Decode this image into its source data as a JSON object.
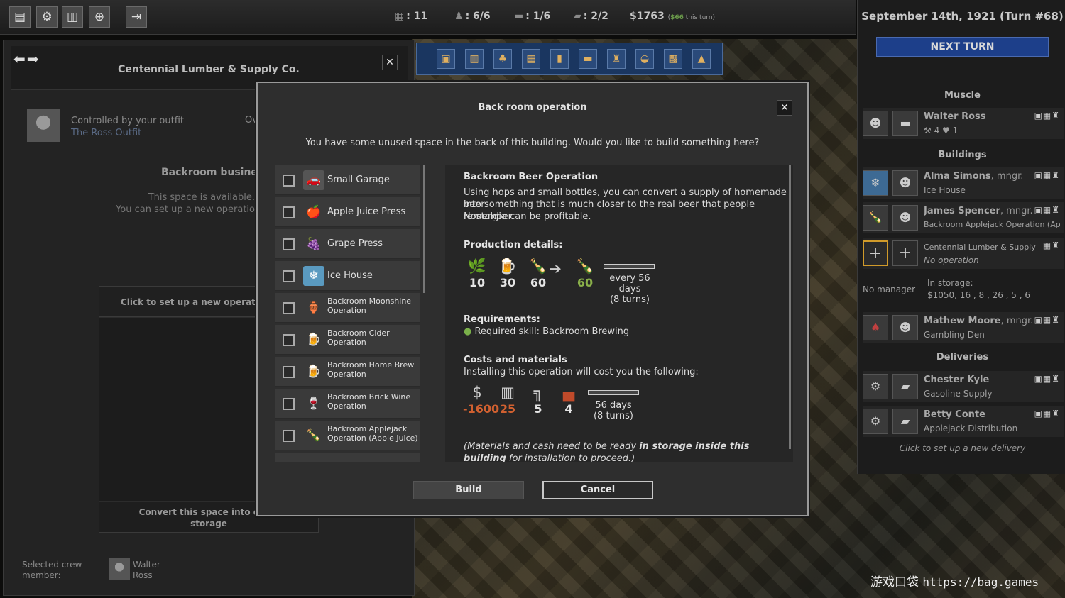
{
  "topbar": {
    "stats": [
      {
        "icon": "building-icon",
        "glyph": "▦",
        "value": ": 11"
      },
      {
        "icon": "crew-icon",
        "glyph": "♟",
        "value": ": 6/6"
      },
      {
        "icon": "vehicle-icon",
        "glyph": "▬",
        "value": ": 1/6"
      },
      {
        "icon": "truck-icon",
        "glyph": "▰",
        "value": ": 2/2"
      }
    ],
    "cash": "$1763",
    "cash_note_prefix": "(",
    "cash_note_value": "$66",
    "cash_note_suffix": " this turn)"
  },
  "left_panel": {
    "title": "Centennial Lumber & Supply Co.",
    "controlled": "Controlled by your outfit",
    "outfit": "The Ross Outfit",
    "ov": "Ov",
    "backroom_title": "Backroom business",
    "avail_line1": "This space is available.",
    "avail_line2": "You can set up a new operatio",
    "setup_label": "Click to set up a new operation",
    "convert_label_1": "Convert this space into extra",
    "convert_label_2": "storage",
    "crew_label_1": "Selected crew",
    "crew_label_2": "member:",
    "crew_name_1": "Walter",
    "crew_name_2": "Ross"
  },
  "right_panel": {
    "date": "September 14th, 1921  (Turn #68)",
    "next_turn": "NEXT TURN",
    "muscle": "Muscle",
    "muscle_name": "Walter Ross",
    "muscle_stats": "⚒ 4  ♥ 1",
    "buildings": "Buildings",
    "rows": [
      {
        "name": "Alma Simons",
        "role": ", mngr.",
        "place": "Ice House"
      },
      {
        "name": "James Spencer",
        "role": ", mngr.",
        "place": "Backroom Applejack Operation (Appl..."
      },
      {
        "name": "Centennial Lumber & Supply",
        "role": "",
        "place": "No operation"
      },
      {
        "name": "Mathew Moore",
        "role": ", mngr.",
        "place": "Gambling Den"
      }
    ],
    "no_manager": "No manager",
    "in_storage": "In storage:",
    "storage_values": "$1050, 16 , 8 , 26 , 5 , 6",
    "deliveries": "Deliveries",
    "deliveries_rows": [
      {
        "name": "Chester Kyle",
        "place": "Gasoline Supply"
      },
      {
        "name": "Betty Conte",
        "place": "Applejack Distribution"
      }
    ],
    "new_delivery": "Click to set up a new delivery"
  },
  "modal": {
    "title": "Back room operation",
    "question": "You have some unused space in the back of this building. Would you like to build something here?",
    "options": [
      {
        "label": "Small Garage",
        "icon": "garage-icon",
        "glyph": "🚗"
      },
      {
        "label": "Apple Juice Press",
        "icon": "apple-icon",
        "glyph": "🍎"
      },
      {
        "label": "Grape Press",
        "icon": "grape-icon",
        "glyph": "🍇"
      },
      {
        "label": "Ice House",
        "icon": "ice-icon",
        "glyph": "❄"
      },
      {
        "label": "Backroom Moonshine Operation",
        "icon": "moonshine-icon",
        "glyph": "🏺"
      },
      {
        "label": "Backroom Cider Operation",
        "icon": "cider-icon",
        "glyph": "🍺"
      },
      {
        "label": "Backroom Home Brew Operation",
        "icon": "brew-icon",
        "glyph": "🍺"
      },
      {
        "label": "Backroom Brick Wine Operation",
        "icon": "wine-icon",
        "glyph": "🍷"
      },
      {
        "label": "Backroom Applejack Operation (Apple Juice)",
        "icon": "applejack-icon",
        "glyph": "🍾"
      }
    ],
    "detail": {
      "name": "Backroom Beer Operation",
      "desc_1": "Using hops and small bottles, you can convert a supply of homemade beer",
      "desc_2": "into something that is much closer to the real beer that people remember.",
      "desc_3": "Nostalgia can be profitable.",
      "production_title": "Production details:",
      "production": [
        {
          "icon": "hops-icon",
          "glyph": "🌿",
          "value": "10"
        },
        {
          "icon": "homebrew-icon",
          "glyph": "🍺",
          "value": "30"
        },
        {
          "icon": "bottle-icon",
          "glyph": "🍾",
          "value": "60"
        },
        {
          "icon": "beer-output-icon",
          "glyph": "🍾",
          "value": "60"
        }
      ],
      "production_every": "every 56 days",
      "production_turns": "(8 turns)",
      "req_title": "Requirements:",
      "req_skill": "Required skill: Backroom Brewing",
      "costs_title": "Costs and materials",
      "costs_desc": "Installing this operation will cost you the following:",
      "costs": [
        {
          "icon": "cash-icon",
          "glyph": "$",
          "value": "-1600"
        },
        {
          "icon": "lumber-icon",
          "glyph": "▥",
          "value": "25"
        },
        {
          "icon": "pipe-icon",
          "glyph": "╗",
          "value": "5"
        },
        {
          "icon": "brick-icon",
          "glyph": "▄",
          "value": "4"
        }
      ],
      "costs_days": "56 days",
      "costs_turns": "(8 turns)",
      "note_pre": "(Materials and cash need to be ready ",
      "note_bold": "in storage inside this building",
      "note_post": " for installation to proceed.)"
    },
    "build": "Build",
    "cancel": "Cancel"
  },
  "watermark": {
    "cn": "游戏口袋",
    "url": "https://bag.games"
  }
}
